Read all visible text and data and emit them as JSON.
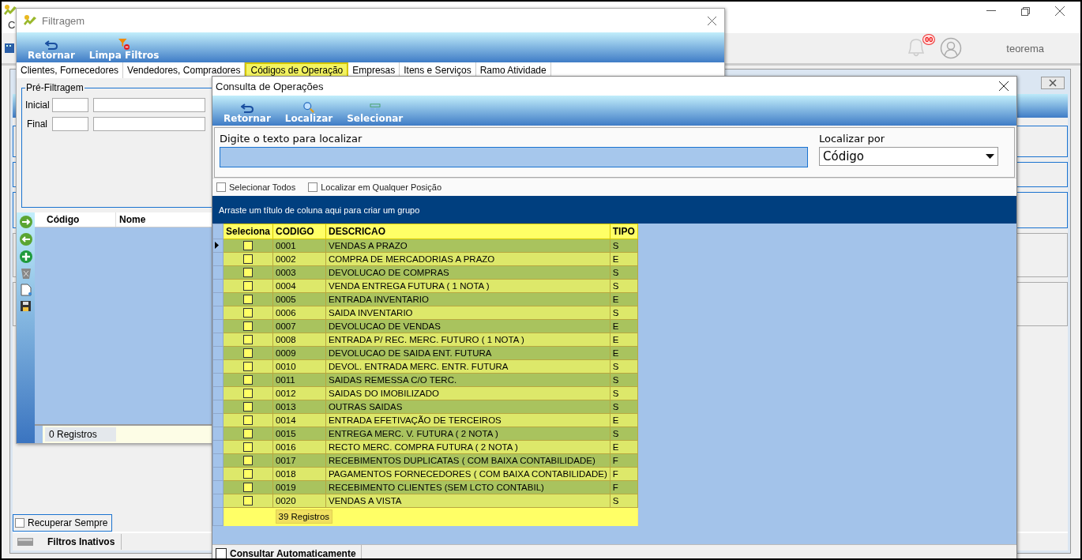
{
  "app": {
    "menu_label": "C",
    "notification_badge": "00",
    "user": "teorema"
  },
  "mdi": {
    "recover": {
      "label": "Recuperar Sempre",
      "checked": false
    },
    "status": "Filtros Inativos"
  },
  "filtragem": {
    "title": "Filtragem",
    "toolbar": [
      {
        "label": "Retornar",
        "kind": "return"
      },
      {
        "label": "Limpa Filtros",
        "kind": "clear_filter"
      }
    ],
    "tabs": [
      {
        "label": "Clientes, Fornecedores",
        "selected": false
      },
      {
        "label": "Vendedores, Compradores",
        "selected": false
      },
      {
        "label": "Códigos de Operação",
        "selected": true
      },
      {
        "label": "Empresas",
        "selected": false
      },
      {
        "label": "Itens e Serviços",
        "selected": false
      },
      {
        "label": "Ramo Atividade",
        "selected": false
      }
    ],
    "prefilter": {
      "title": "Pré-Filtragem",
      "fields": [
        {
          "label": "Inicial"
        },
        {
          "label": "Final"
        }
      ]
    },
    "grid": {
      "columns": [
        "Código",
        "Nome"
      ],
      "footer": "0 Registros"
    }
  },
  "consulta": {
    "title": "Consulta de Operações",
    "toolbar": [
      {
        "label": "Retornar",
        "kind": "return"
      },
      {
        "label": "Localizar",
        "kind": "search"
      },
      {
        "label": "Selecionar",
        "kind": "select"
      }
    ],
    "search": {
      "label": "Digite o texto para localizar"
    },
    "search_by": {
      "label": "Localizar por",
      "value": "Código"
    },
    "options": [
      {
        "label": "Selecionar Todos",
        "checked": false
      },
      {
        "label": "Localizar em Qualquer Posição",
        "checked": false
      }
    ],
    "group_hint": "Arraste um título de coluna aqui para criar um grupo",
    "table": {
      "columns": [
        "Seleciona",
        "CODIGO",
        "DESCRICAO",
        "TIPO"
      ],
      "rows": [
        {
          "selected": true,
          "checked": false,
          "code": "0001",
          "description": "VENDAS A PRAZO",
          "type": "S"
        },
        {
          "selected": false,
          "checked": false,
          "code": "0002",
          "description": "COMPRA DE MERCADORIAS A PRAZO",
          "type": "E"
        },
        {
          "selected": false,
          "checked": false,
          "code": "0003",
          "description": "DEVOLUCAO DE COMPRAS",
          "type": "S"
        },
        {
          "selected": false,
          "checked": false,
          "code": "0004",
          "description": "VENDA ENTREGA FUTURA ( 1 NOTA )",
          "type": "S"
        },
        {
          "selected": false,
          "checked": false,
          "code": "0005",
          "description": "ENTRADA INVENTARIO",
          "type": "E"
        },
        {
          "selected": false,
          "checked": false,
          "code": "0006",
          "description": "SAIDA INVENTARIO",
          "type": "S"
        },
        {
          "selected": false,
          "checked": false,
          "code": "0007",
          "description": "DEVOLUCAO DE VENDAS",
          "type": "E"
        },
        {
          "selected": false,
          "checked": false,
          "code": "0008",
          "description": "ENTRADA P/ REC. MERC. FUTURO ( 1 NOTA )",
          "type": "E"
        },
        {
          "selected": false,
          "checked": false,
          "code": "0009",
          "description": "DEVOLUCAO DE SAIDA ENT. FUTURA",
          "type": "E"
        },
        {
          "selected": false,
          "checked": false,
          "code": "0010",
          "description": "DEVOL. ENTRADA  MERC. ENTR. FUTURA",
          "type": "S"
        },
        {
          "selected": false,
          "checked": false,
          "code": "0011",
          "description": "SAIDAS REMESSA C/O TERC.",
          "type": "S"
        },
        {
          "selected": false,
          "checked": false,
          "code": "0012",
          "description": "SAIDAS DO IMOBILIZADO",
          "type": "S"
        },
        {
          "selected": false,
          "checked": false,
          "code": "0013",
          "description": "OUTRAS SAIDAS",
          "type": "S"
        },
        {
          "selected": false,
          "checked": false,
          "code": "0014",
          "description": "ENTRADA EFETIVAÇÃO DE TERCEIROS",
          "type": "E"
        },
        {
          "selected": false,
          "checked": false,
          "code": "0015",
          "description": "ENTREGA MERC. V. FUTURA ( 2 NOTA )",
          "type": "S"
        },
        {
          "selected": false,
          "checked": false,
          "code": "0016",
          "description": "RECTO MERC. COMPRA FUTURA ( 2 NOTA )",
          "type": "E"
        },
        {
          "selected": false,
          "checked": false,
          "code": "0017",
          "description": "RECEBIMENTOS DUPLICATAS ( COM BAIXA CONTABILIDADE)",
          "type": "F"
        },
        {
          "selected": false,
          "checked": false,
          "code": "0018",
          "description": "PAGAMENTOS FORNECEDORES ( COM BAIXA CONTABILIDADE)",
          "type": "F"
        },
        {
          "selected": false,
          "checked": false,
          "code": "0019",
          "description": "RECEBIMENTO CLIENTES (SEM LCTO CONTABIL)",
          "type": "F"
        },
        {
          "selected": false,
          "checked": false,
          "code": "0020",
          "description": "VENDAS A VISTA",
          "type": "S"
        }
      ],
      "footer": "39 Registros"
    },
    "auto_query": {
      "label": "Consultar Automaticamente",
      "checked": false
    }
  }
}
